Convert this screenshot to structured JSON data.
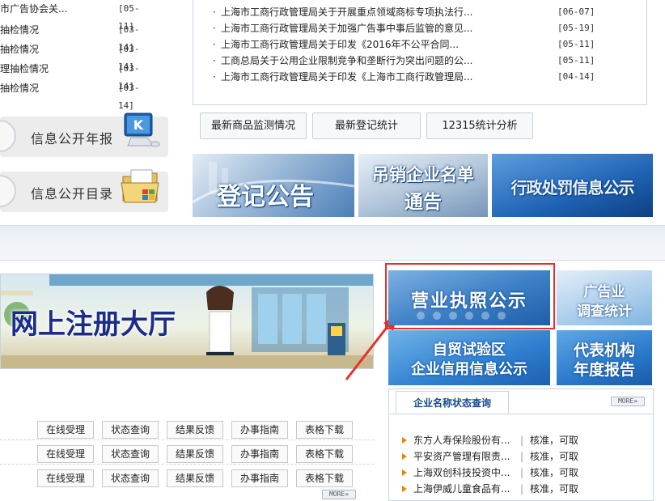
{
  "left_list": [
    {
      "title": "市广告协会关...",
      "date": "[05-11]"
    },
    {
      "title": "抽检情况",
      "date": "[03-14]"
    },
    {
      "title": "抽检情况",
      "date": "[03-14]"
    },
    {
      "title": "理抽检情况",
      "date": "[03-14]"
    },
    {
      "title": "抽检情况",
      "date": "[03-14]"
    }
  ],
  "info_buttons": [
    {
      "label": "信息公开年报",
      "icon": "kg-monitor-icon"
    },
    {
      "label": "信息公开目录",
      "icon": "windows-folder-icon"
    }
  ],
  "news": [
    {
      "title": "上海市工商行政管理局关于开展重点领域商标专项执法行...",
      "date": "[06-07]"
    },
    {
      "title": "上海市工商行政管理局关于加强广告事中事后监管的意见...",
      "date": "[05-19]"
    },
    {
      "title": "上海市工商行政管理局关于印发《2016年不公平合同...",
      "date": "[05-11]"
    },
    {
      "title": "工商总局关于公用企业限制竞争和垄断行为突出问题的公...",
      "date": "[05-11]"
    },
    {
      "title": "上海市工商行政管理局关于印发《上海市工商行政管理局...",
      "date": "[04-14]"
    }
  ],
  "tabs": [
    "最新商品监测情况",
    "最新登记统计",
    "12315统计分析"
  ],
  "banners": {
    "register": "登记公告",
    "revoke_line1": "吊销企业名单",
    "revoke_line2": "通告",
    "penalty": "行政处罚信息公示"
  },
  "hall": {
    "title": "网上注册大厅"
  },
  "tiles": {
    "license": "营业执照公示",
    "ad_line1": "广告业",
    "ad_line2": "调查统计",
    "ftz_line1": "自贸试验区",
    "ftz_line2": "企业信用信息公示",
    "rep_line1": "代表机构",
    "rep_line2": "年度报告"
  },
  "actions": [
    "在线受理",
    "状态查询",
    "结果反馈",
    "办事指南",
    "表格下载"
  ],
  "more_label": "MORE»",
  "ent": {
    "tab": "企业名称状态查询",
    "rows": [
      {
        "name": "东方人寿保险股份有...",
        "status": "核准，可取"
      },
      {
        "name": "平安资产管理有限责...",
        "status": "核准，可取"
      },
      {
        "name": "上海双创科技投资中...",
        "status": "核准，可取"
      },
      {
        "name": "上海伊威儿童食品有...",
        "status": "核准，可取"
      }
    ]
  },
  "colors": {
    "accent_blue": "#174a86",
    "highlight_red": "#e4312b",
    "arrow_orange": "#e08a00"
  }
}
